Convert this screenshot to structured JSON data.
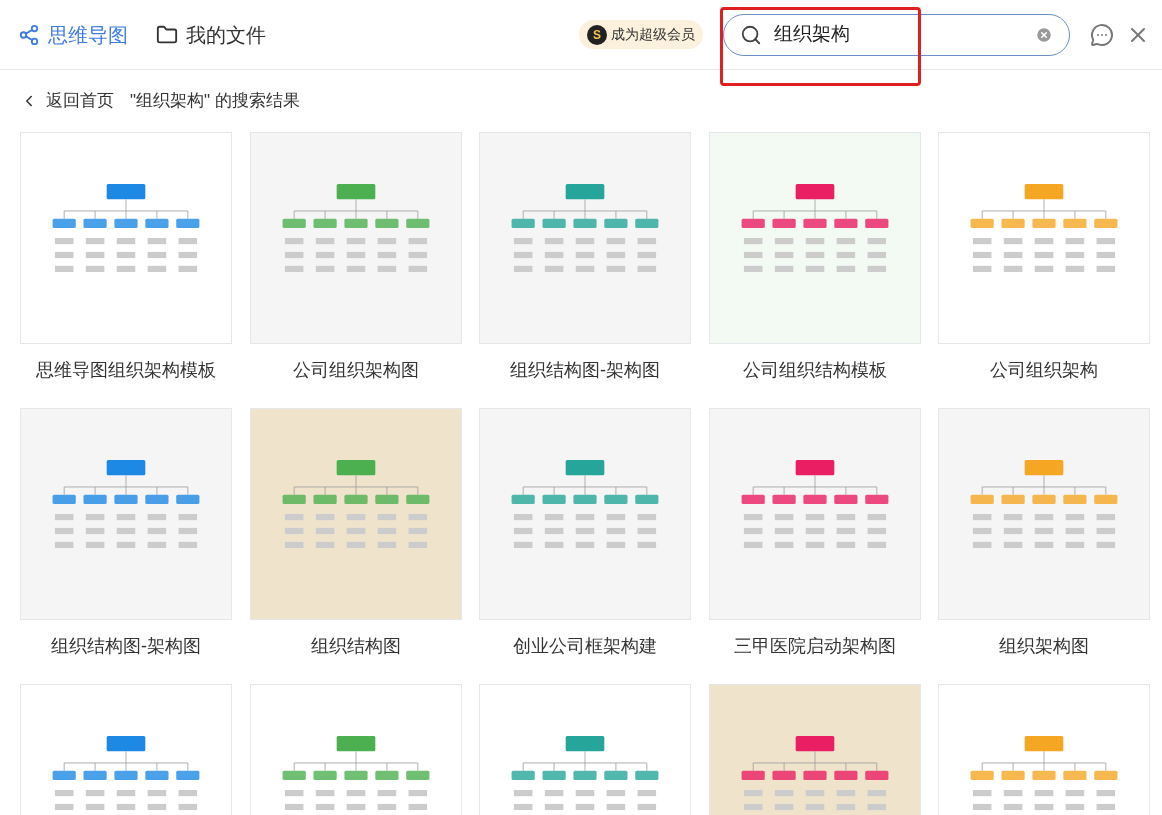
{
  "nav": [
    {
      "label": "思维导图",
      "selected": true,
      "kind": "mindmap"
    },
    {
      "label": "我的文件",
      "selected": false,
      "kind": "folder"
    }
  ],
  "vip_badge": {
    "label": "成为超级会员",
    "icon": "S"
  },
  "search": {
    "value": "组织架构",
    "highlighted": true
  },
  "breadcrumb": {
    "back": "返回首页",
    "result": "\"组织架构\" 的搜索结果"
  },
  "templates": [
    {
      "title": "思维导图组织架构模板",
      "color": "#ffffff"
    },
    {
      "title": "公司组织架构图",
      "color": "#f5f5f5"
    },
    {
      "title": "组织结构图-架构图",
      "color": "#f5f5f5"
    },
    {
      "title": "公司组织结构模板",
      "color": "#f3faf3"
    },
    {
      "title": "公司组织架构",
      "color": "#ffffff"
    },
    {
      "title": "组织结构图-架构图",
      "color": "#f5f5f5"
    },
    {
      "title": "组织结构图",
      "color": "#efe3cc"
    },
    {
      "title": "创业公司框架构建",
      "color": "#f5f5f5"
    },
    {
      "title": "三甲医院启动架构图",
      "color": "#f5f5f5"
    },
    {
      "title": "组织架构图",
      "color": "#f5f5f5"
    },
    {
      "color": "#ffffff"
    },
    {
      "color": "#ffffff"
    },
    {
      "color": "#ffffff"
    },
    {
      "color": "#efe3cc"
    },
    {
      "color": "#ffffff"
    }
  ]
}
